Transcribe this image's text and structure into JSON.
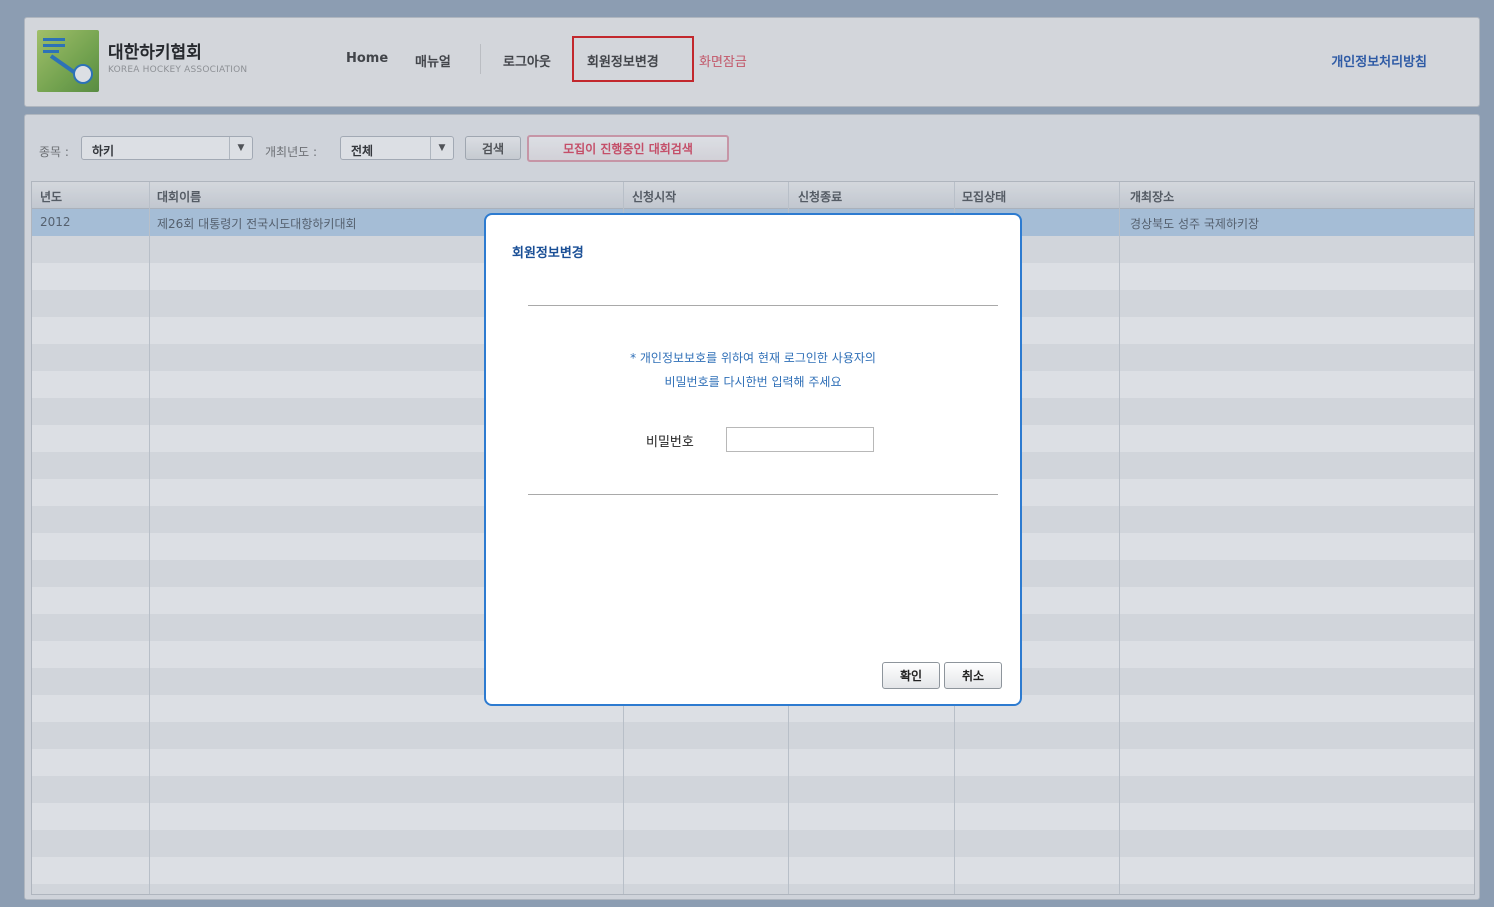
{
  "header": {
    "org_name": "대한하키협회",
    "org_sub": "KOREA HOCKEY ASSOCIATION",
    "nav": {
      "home": "Home",
      "manual": "매뉴얼",
      "logout": "로그아웃",
      "member_info": "회원정보변경",
      "screen_lock": "화면잠금"
    },
    "privacy_link": "개인정보처리방침"
  },
  "filters": {
    "sport_label": "종목 :",
    "sport_value": "하키",
    "year_label": "개최년도 :",
    "year_value": "전체",
    "search_button": "검색",
    "recruit_button": "모집이 진행중인 대회검색"
  },
  "grid": {
    "columns": [
      "년도",
      "대회이름",
      "신청시작",
      "신청종료",
      "모집상태",
      "개최장소"
    ],
    "rows": [
      {
        "year": "2012",
        "name": "제26회 대통령기 전국시도대항하키대회",
        "venue": "경상북도 성주 국제하키장"
      }
    ]
  },
  "modal": {
    "title": "회원정보변경",
    "message_line1": "* 개인정보보호를 위하여 현재 로그인한 사용자의",
    "message_line2": "비밀번호를 다시한번 입력해 주세요",
    "password_label": "비밀번호",
    "password_value": "",
    "confirm_button": "확인",
    "cancel_button": "취소"
  },
  "colors": {
    "accent_blue": "#2d7bd0",
    "highlight_red": "#e02020",
    "selected_row": "#bcd6ee",
    "recruit_pink": "#e2506a"
  }
}
